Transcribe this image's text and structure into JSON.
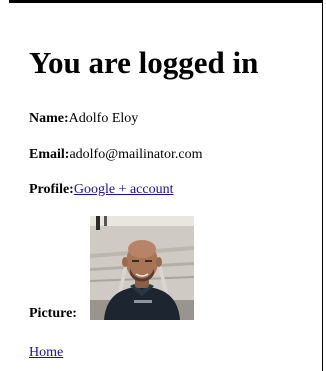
{
  "heading": "You are logged in",
  "name": {
    "label": "Name:",
    "value": "Adolfo Eloy"
  },
  "email": {
    "label": "Email:",
    "value": "adolfo@mailinator.com"
  },
  "profile": {
    "label": "Profile:",
    "link_text": "Google + account"
  },
  "picture": {
    "label": "Picture:",
    "alt": "Profile picture"
  },
  "home_link": "Home",
  "colors": {
    "link": "#1a0dab",
    "text": "#000000",
    "background": "#ffffff"
  }
}
